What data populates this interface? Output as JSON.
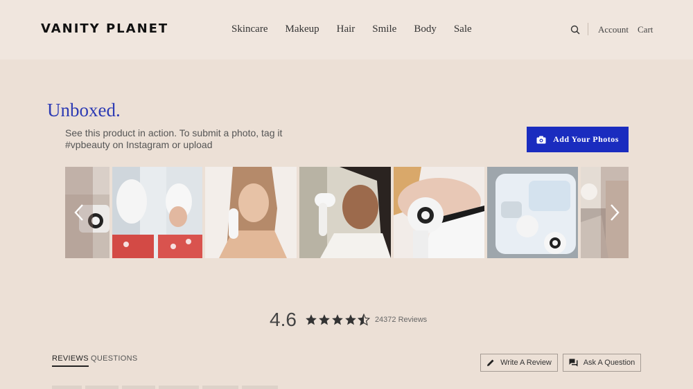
{
  "header": {
    "logo": "VANITY PLANET",
    "nav": [
      "Skincare",
      "Makeup",
      "Hair",
      "Smile",
      "Body",
      "Sale"
    ],
    "account": "Account",
    "cart": "Cart"
  },
  "unboxed": {
    "title": "Unboxed.",
    "description": "See this product in action. To submit a photo, tag it #vpbeauty on Instagram or upload",
    "add_button": "Add Your Photos"
  },
  "carousel": {
    "photos": [
      "photo-device-box",
      "photo-towel-mirror",
      "photo-woman-cleansing",
      "photo-woman-robe",
      "photo-brush-closeup",
      "photo-device-kit",
      "photo-counter-products"
    ]
  },
  "rating": {
    "score": "4.6",
    "stars": 4.6,
    "count": "24372 Reviews"
  },
  "tabs": {
    "reviews": "REVIEWS",
    "questions": "QUESTIONS"
  },
  "actions": {
    "write_review": "Write A Review",
    "ask_question": "Ask A Question"
  },
  "colors": {
    "background": "#ece0d6",
    "header": "#f0e6de",
    "accent": "#1a2cbf",
    "title": "#2d3bb4"
  }
}
